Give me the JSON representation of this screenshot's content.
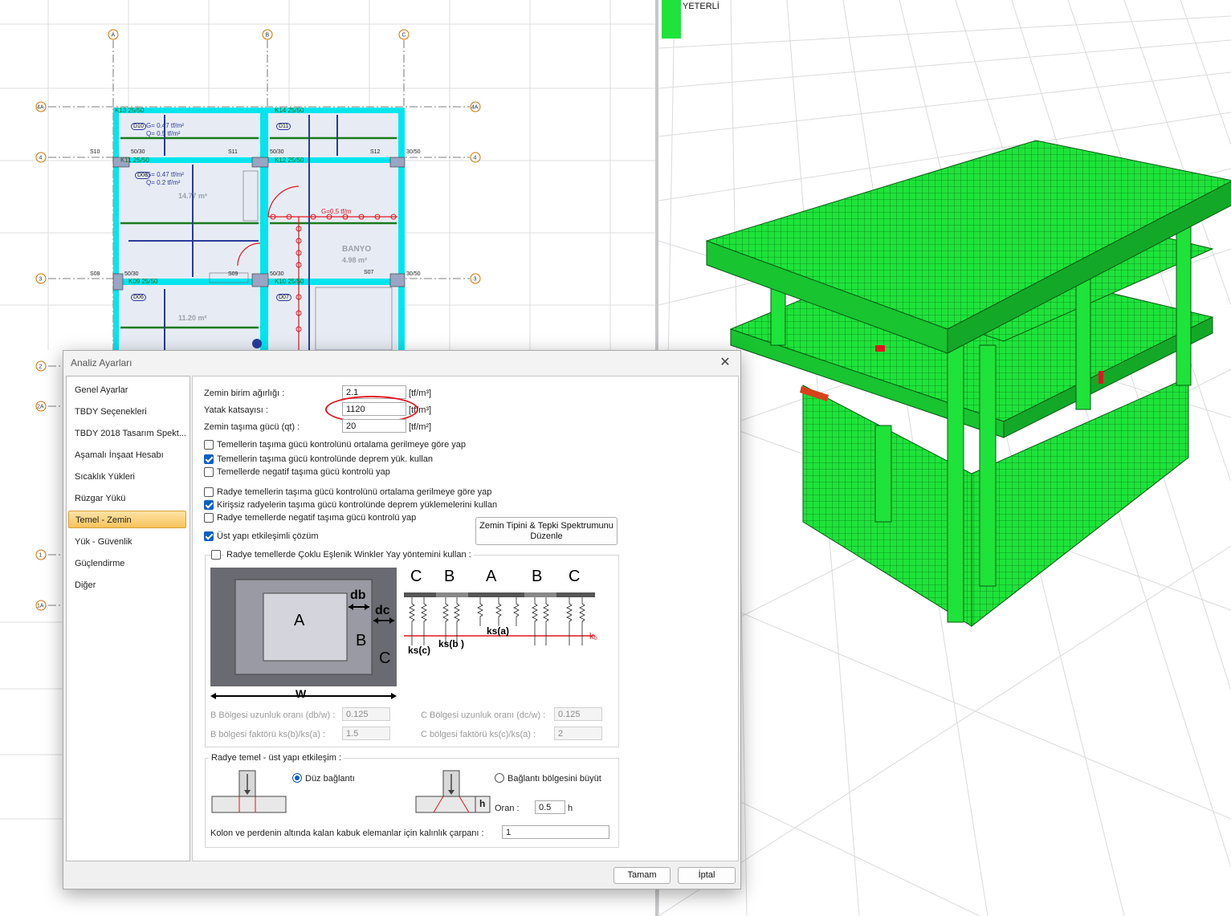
{
  "plan": {
    "axis_labels": [
      "A",
      "B",
      "C",
      "4A",
      "4",
      "3",
      "2",
      "2A",
      "1",
      "1A"
    ],
    "beam_labels": [
      "K13 25/50",
      "K14 25/50",
      "K11 25/50",
      "K12 25/50",
      "K09 25/50",
      "K10 25/50"
    ],
    "slab_labels": [
      "S10",
      "S11",
      "S12",
      "S08",
      "S09",
      "S07"
    ],
    "column_labels": [
      "50/30",
      "50/30",
      "30/50",
      "50/30",
      "50/30",
      "30/50"
    ],
    "room_labels": [
      "BANYO",
      "4.98 m²",
      "14.77 m²",
      "11.20 m²"
    ],
    "load_labels": [
      "G= 0.47 tf/m²",
      "Q= 0.5 tf/m²",
      "G=0.5 tf/m",
      "G= 0.47 tf/m²",
      "Q= 0.2 tf/m²"
    ],
    "slab_ids": [
      "D10",
      "D11",
      "D08",
      "D06",
      "D07"
    ]
  },
  "status": {
    "text": "YETERLİ",
    "color": "#1ee33a"
  },
  "dialog": {
    "title": "Analiz Ayarları",
    "close_glyph": "✕",
    "nav_items": [
      {
        "label": "Genel Ayarlar"
      },
      {
        "label": "TBDY Seçenekleri"
      },
      {
        "label": "TBDY 2018 Tasarım Spekt..."
      },
      {
        "label": "Aşamalı İnşaat Hesabı"
      },
      {
        "label": "Sıcaklık Yükleri"
      },
      {
        "label": "Rüzgar Yükü"
      },
      {
        "label": "Temel - Zemin"
      },
      {
        "label": "Yük - Güvenlik"
      },
      {
        "label": "Güçlendirme"
      },
      {
        "label": "Diğer"
      }
    ],
    "active_nav": "Temel - Zemin",
    "fields": {
      "soil_unit_weight": {
        "label": "Zemin birim ağırlığı :",
        "value": "2.1",
        "unit": "[tf/m³]"
      },
      "bed_coefficient": {
        "label": "Yatak katsayısı :",
        "value": "1120",
        "unit": "[tf/m³]"
      },
      "bearing_capacity": {
        "label": "Zemin taşıma gücü (qt) :",
        "value": "20",
        "unit": "[tf/m²]"
      }
    },
    "checks": [
      {
        "label": "Temellerin taşıma gücü kontrolünü ortalama gerilmeye göre yap",
        "checked": false
      },
      {
        "label": "Temellerin taşıma gücü kontrolünde deprem yük. kullan",
        "checked": true
      },
      {
        "label": "Temellerde negatif taşıma gücü kontrolü yap",
        "checked": false
      },
      {
        "label": "Radye temellerin taşıma gücü kontrolünü ortalama gerilmeye göre yap",
        "checked": false
      },
      {
        "label": "Kirişsiz radyelerin taşıma gücü kontrolünde deprem yüklemelerini kullan",
        "checked": true
      },
      {
        "label": "Radye temellerde negatif taşıma gücü kontrolü yap",
        "checked": false
      },
      {
        "label": "Üst yapı etkileşimli çözüm",
        "checked": true
      }
    ],
    "spectrum_button": {
      "line1": "Zemin Tipini  & Tepki Spektrumunu",
      "line2": "Düzenle"
    },
    "winkler": {
      "label": "Radye temellerde Çoklu Eşlenik Winkler Yay yöntemini kullan :",
      "checked": false,
      "diagram_plan": {
        "a": "A",
        "b": "B",
        "c": "C",
        "db": "db",
        "dc": "dc",
        "w": "W"
      },
      "diagram_section": {
        "letters": [
          "C",
          "B",
          "A",
          "B",
          "C"
        ],
        "ks_a": "ks(a)",
        "ks_b": "ks(b )",
        "ks_c": "ks(c)",
        "ko": "k₀"
      },
      "params": [
        {
          "label": "B Bölgesi uzunluk oranı (db/w) :",
          "value": "0.125"
        },
        {
          "label": "C Bölgesi uzunluk oranı (dc/w) :",
          "value": "0.125"
        },
        {
          "label": "B bölgesi faktörü ks(b)/ks(a) :",
          "value": "1.5"
        },
        {
          "label": "C bölgesi faktörü ks(c)/ks(a) :",
          "value": "2"
        }
      ]
    },
    "interaction": {
      "title": "Radye temel - üst yapı etkileşim :",
      "option1": {
        "label": "Düz bağlantı",
        "selected": true
      },
      "option2": {
        "label": "Bağlantı bölgesini büyüt",
        "selected": false
      },
      "ratio_label": "Oran :",
      "ratio_value": "0.5",
      "ratio_unit": "h",
      "h_label": "h",
      "thickness_label": "Kolon ve perdenin altında kalan kabuk elemanlar için kalınlık çarpanı :",
      "thickness_value": "1"
    },
    "buttons": {
      "ok": "Tamam",
      "cancel": "İptal"
    }
  },
  "colors": {
    "accent_blue": "#0b5fc2",
    "highlight_red": "#e0161f",
    "model_green": "#1ee33a",
    "plan_cyan": "#00e5ee",
    "nav_active": "#f7c35b"
  }
}
